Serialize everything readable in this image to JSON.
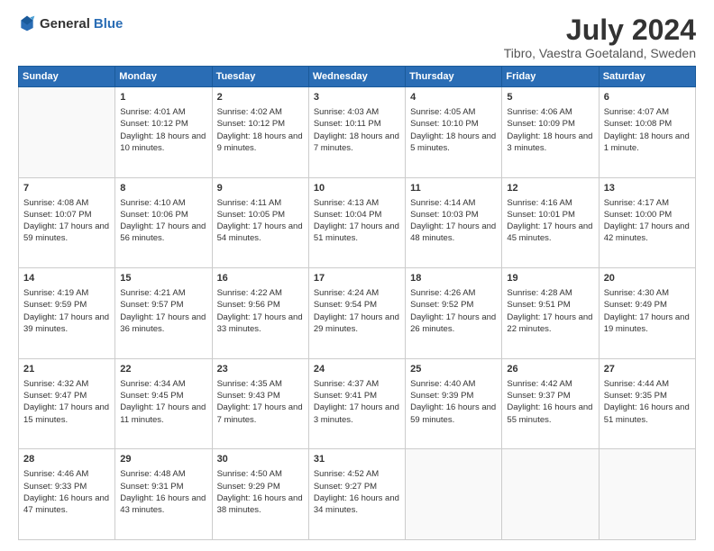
{
  "header": {
    "logo_general": "General",
    "logo_blue": "Blue",
    "title": "July 2024",
    "location": "Tibro, Vaestra Goetaland, Sweden"
  },
  "days_of_week": [
    "Sunday",
    "Monday",
    "Tuesday",
    "Wednesday",
    "Thursday",
    "Friday",
    "Saturday"
  ],
  "weeks": [
    [
      {
        "day": "",
        "sunrise": "",
        "sunset": "",
        "daylight": ""
      },
      {
        "day": "1",
        "sunrise": "Sunrise: 4:01 AM",
        "sunset": "Sunset: 10:12 PM",
        "daylight": "Daylight: 18 hours and 10 minutes."
      },
      {
        "day": "2",
        "sunrise": "Sunrise: 4:02 AM",
        "sunset": "Sunset: 10:12 PM",
        "daylight": "Daylight: 18 hours and 9 minutes."
      },
      {
        "day": "3",
        "sunrise": "Sunrise: 4:03 AM",
        "sunset": "Sunset: 10:11 PM",
        "daylight": "Daylight: 18 hours and 7 minutes."
      },
      {
        "day": "4",
        "sunrise": "Sunrise: 4:05 AM",
        "sunset": "Sunset: 10:10 PM",
        "daylight": "Daylight: 18 hours and 5 minutes."
      },
      {
        "day": "5",
        "sunrise": "Sunrise: 4:06 AM",
        "sunset": "Sunset: 10:09 PM",
        "daylight": "Daylight: 18 hours and 3 minutes."
      },
      {
        "day": "6",
        "sunrise": "Sunrise: 4:07 AM",
        "sunset": "Sunset: 10:08 PM",
        "daylight": "Daylight: 18 hours and 1 minute."
      }
    ],
    [
      {
        "day": "7",
        "sunrise": "Sunrise: 4:08 AM",
        "sunset": "Sunset: 10:07 PM",
        "daylight": "Daylight: 17 hours and 59 minutes."
      },
      {
        "day": "8",
        "sunrise": "Sunrise: 4:10 AM",
        "sunset": "Sunset: 10:06 PM",
        "daylight": "Daylight: 17 hours and 56 minutes."
      },
      {
        "day": "9",
        "sunrise": "Sunrise: 4:11 AM",
        "sunset": "Sunset: 10:05 PM",
        "daylight": "Daylight: 17 hours and 54 minutes."
      },
      {
        "day": "10",
        "sunrise": "Sunrise: 4:13 AM",
        "sunset": "Sunset: 10:04 PM",
        "daylight": "Daylight: 17 hours and 51 minutes."
      },
      {
        "day": "11",
        "sunrise": "Sunrise: 4:14 AM",
        "sunset": "Sunset: 10:03 PM",
        "daylight": "Daylight: 17 hours and 48 minutes."
      },
      {
        "day": "12",
        "sunrise": "Sunrise: 4:16 AM",
        "sunset": "Sunset: 10:01 PM",
        "daylight": "Daylight: 17 hours and 45 minutes."
      },
      {
        "day": "13",
        "sunrise": "Sunrise: 4:17 AM",
        "sunset": "Sunset: 10:00 PM",
        "daylight": "Daylight: 17 hours and 42 minutes."
      }
    ],
    [
      {
        "day": "14",
        "sunrise": "Sunrise: 4:19 AM",
        "sunset": "Sunset: 9:59 PM",
        "daylight": "Daylight: 17 hours and 39 minutes."
      },
      {
        "day": "15",
        "sunrise": "Sunrise: 4:21 AM",
        "sunset": "Sunset: 9:57 PM",
        "daylight": "Daylight: 17 hours and 36 minutes."
      },
      {
        "day": "16",
        "sunrise": "Sunrise: 4:22 AM",
        "sunset": "Sunset: 9:56 PM",
        "daylight": "Daylight: 17 hours and 33 minutes."
      },
      {
        "day": "17",
        "sunrise": "Sunrise: 4:24 AM",
        "sunset": "Sunset: 9:54 PM",
        "daylight": "Daylight: 17 hours and 29 minutes."
      },
      {
        "day": "18",
        "sunrise": "Sunrise: 4:26 AM",
        "sunset": "Sunset: 9:52 PM",
        "daylight": "Daylight: 17 hours and 26 minutes."
      },
      {
        "day": "19",
        "sunrise": "Sunrise: 4:28 AM",
        "sunset": "Sunset: 9:51 PM",
        "daylight": "Daylight: 17 hours and 22 minutes."
      },
      {
        "day": "20",
        "sunrise": "Sunrise: 4:30 AM",
        "sunset": "Sunset: 9:49 PM",
        "daylight": "Daylight: 17 hours and 19 minutes."
      }
    ],
    [
      {
        "day": "21",
        "sunrise": "Sunrise: 4:32 AM",
        "sunset": "Sunset: 9:47 PM",
        "daylight": "Daylight: 17 hours and 15 minutes."
      },
      {
        "day": "22",
        "sunrise": "Sunrise: 4:34 AM",
        "sunset": "Sunset: 9:45 PM",
        "daylight": "Daylight: 17 hours and 11 minutes."
      },
      {
        "day": "23",
        "sunrise": "Sunrise: 4:35 AM",
        "sunset": "Sunset: 9:43 PM",
        "daylight": "Daylight: 17 hours and 7 minutes."
      },
      {
        "day": "24",
        "sunrise": "Sunrise: 4:37 AM",
        "sunset": "Sunset: 9:41 PM",
        "daylight": "Daylight: 17 hours and 3 minutes."
      },
      {
        "day": "25",
        "sunrise": "Sunrise: 4:40 AM",
        "sunset": "Sunset: 9:39 PM",
        "daylight": "Daylight: 16 hours and 59 minutes."
      },
      {
        "day": "26",
        "sunrise": "Sunrise: 4:42 AM",
        "sunset": "Sunset: 9:37 PM",
        "daylight": "Daylight: 16 hours and 55 minutes."
      },
      {
        "day": "27",
        "sunrise": "Sunrise: 4:44 AM",
        "sunset": "Sunset: 9:35 PM",
        "daylight": "Daylight: 16 hours and 51 minutes."
      }
    ],
    [
      {
        "day": "28",
        "sunrise": "Sunrise: 4:46 AM",
        "sunset": "Sunset: 9:33 PM",
        "daylight": "Daylight: 16 hours and 47 minutes."
      },
      {
        "day": "29",
        "sunrise": "Sunrise: 4:48 AM",
        "sunset": "Sunset: 9:31 PM",
        "daylight": "Daylight: 16 hours and 43 minutes."
      },
      {
        "day": "30",
        "sunrise": "Sunrise: 4:50 AM",
        "sunset": "Sunset: 9:29 PM",
        "daylight": "Daylight: 16 hours and 38 minutes."
      },
      {
        "day": "31",
        "sunrise": "Sunrise: 4:52 AM",
        "sunset": "Sunset: 9:27 PM",
        "daylight": "Daylight: 16 hours and 34 minutes."
      },
      {
        "day": "",
        "sunrise": "",
        "sunset": "",
        "daylight": ""
      },
      {
        "day": "",
        "sunrise": "",
        "sunset": "",
        "daylight": ""
      },
      {
        "day": "",
        "sunrise": "",
        "sunset": "",
        "daylight": ""
      }
    ]
  ]
}
